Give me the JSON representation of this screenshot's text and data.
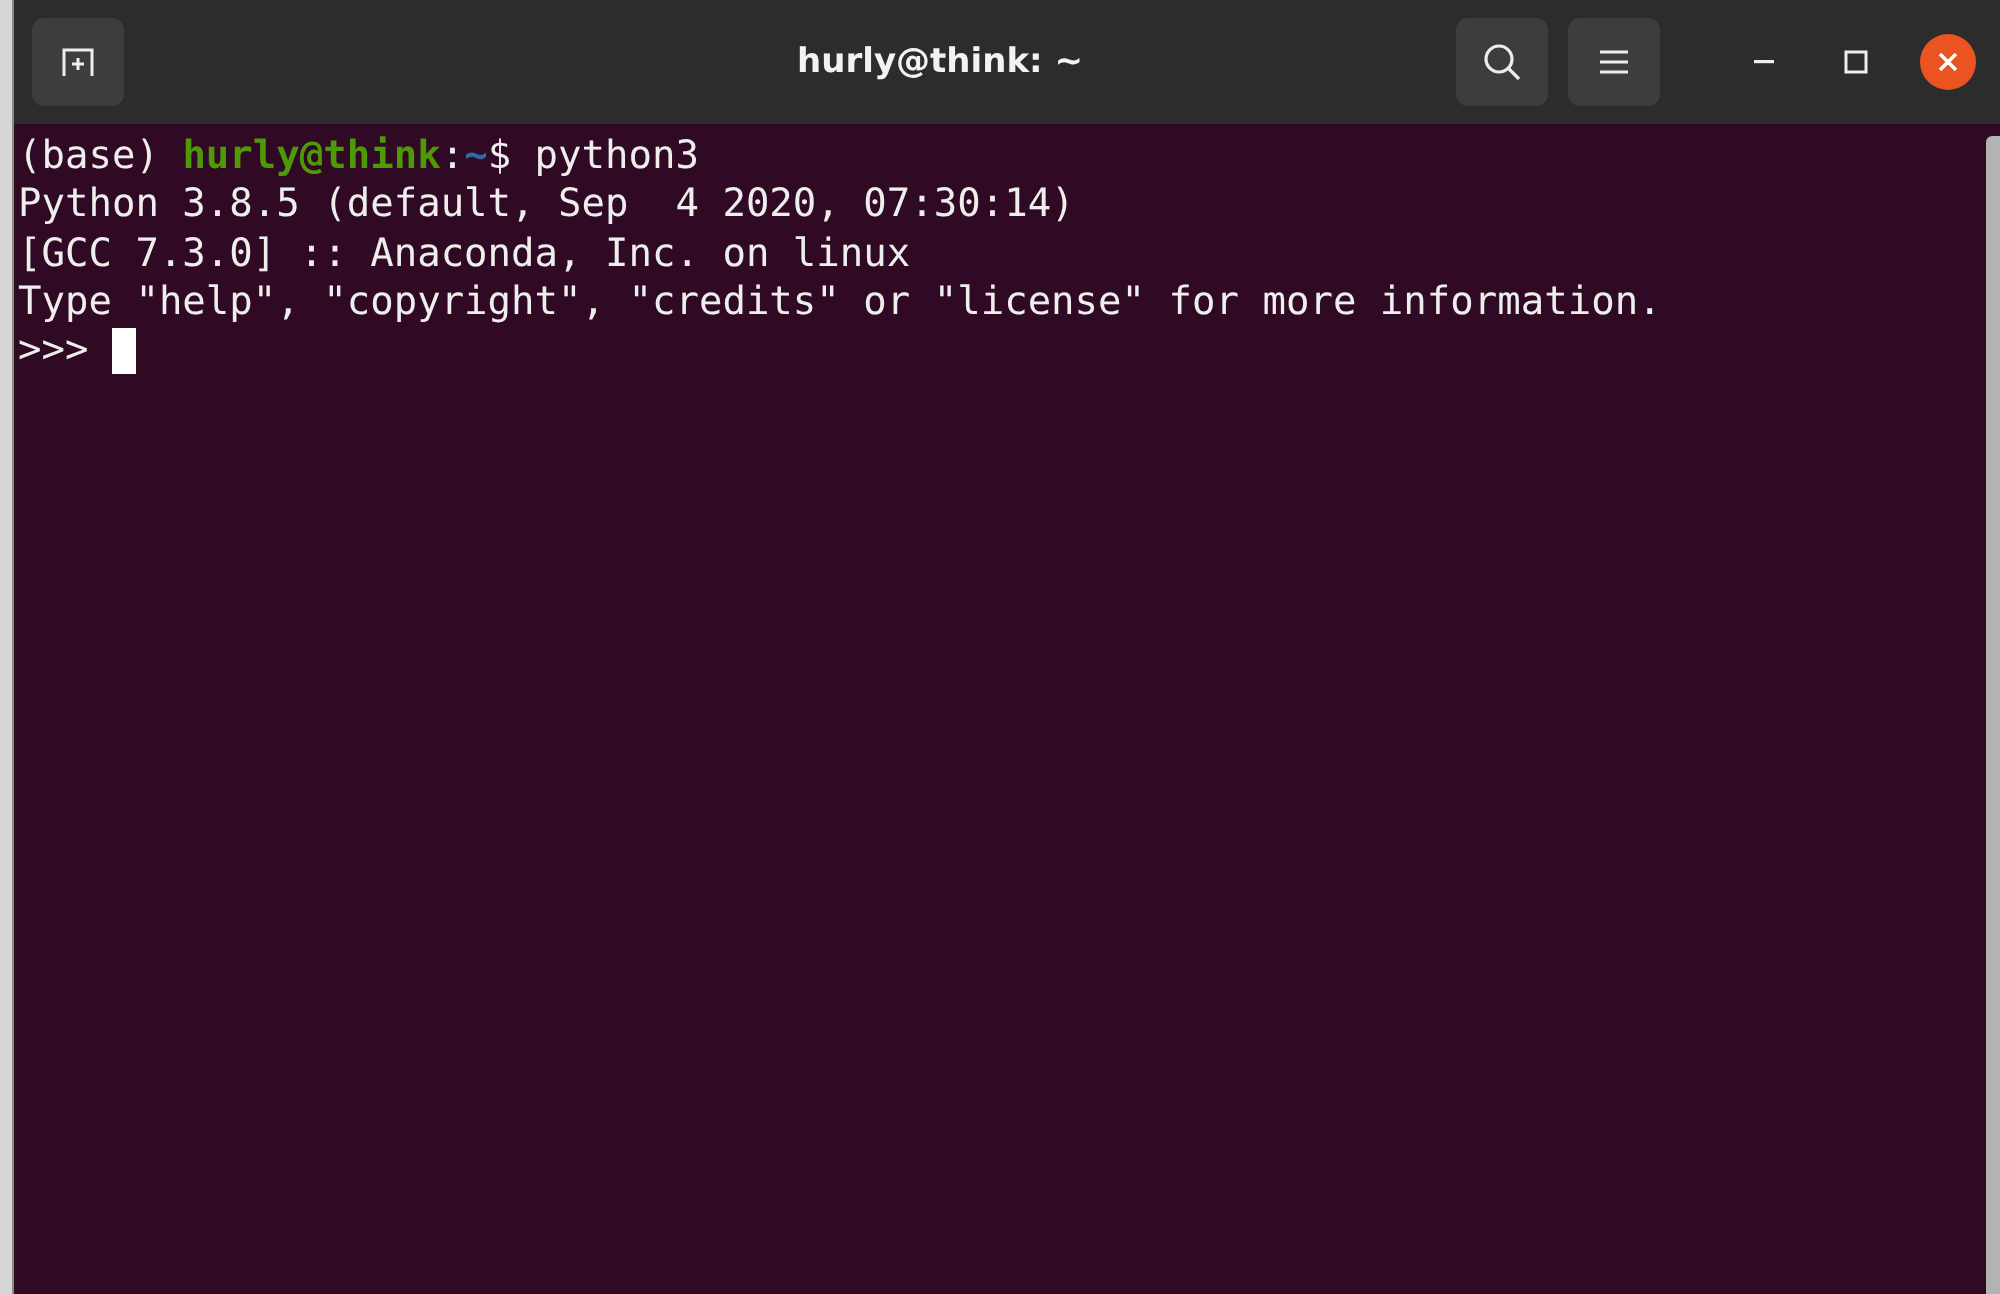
{
  "window": {
    "title": "hurly@think: ~"
  },
  "prompt": {
    "env": "(base)",
    "user": "hurly@think",
    "separator": ":",
    "path": "~",
    "symbol": "$",
    "command": "python3"
  },
  "output": [
    "Python 3.8.5 (default, Sep  4 2020, 07:30:14)",
    "[GCC 7.3.0] :: Anaconda, Inc. on linux",
    "Type \"help\", \"copyright\", \"credits\" or \"license\" for more information."
  ],
  "repl": {
    "prompt": ">>>"
  }
}
